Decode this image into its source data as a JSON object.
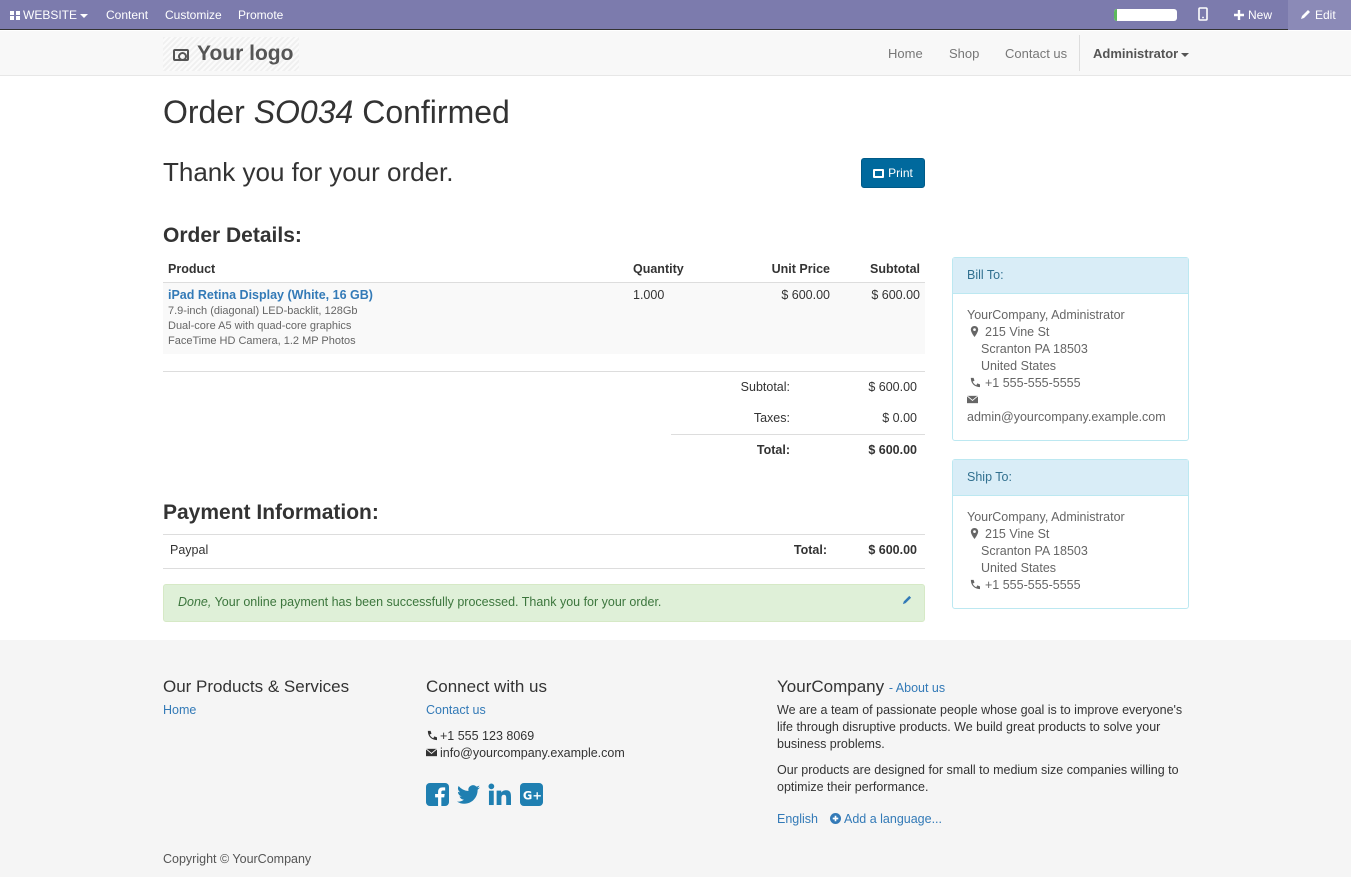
{
  "adminbar": {
    "website": "WEBSITE",
    "content": "Content",
    "customize": "Customize",
    "promote": "Promote",
    "progress": 0.05,
    "new": "New",
    "edit": "Edit"
  },
  "navbar": {
    "logo": "Your logo",
    "home": "Home",
    "shop": "Shop",
    "contact": "Contact us",
    "user": "Administrator"
  },
  "order": {
    "title_prefix": "Order",
    "title_ref": "SO034",
    "title_suffix": "Confirmed",
    "thanks": "Thank you for your order.",
    "print": "Print",
    "details_heading": "Order Details:",
    "columns": [
      "Product",
      "Quantity",
      "Unit Price",
      "Subtotal"
    ],
    "line": {
      "name": "iPad Retina Display (White, 16 GB)",
      "desc1": "7.9-inch (diagonal) LED-backlit, 128Gb",
      "desc2": "Dual-core A5 with quad-core graphics",
      "desc3": "FaceTime HD Camera, 1.2 MP Photos",
      "qty": "1.000",
      "unit": "$ 600.00",
      "subtotal": "$ 600.00"
    },
    "subtotal_label": "Subtotal:",
    "subtotal_value": "$ 600.00",
    "taxes_label": "Taxes:",
    "taxes_value": "$ 0.00",
    "total_label": "Total:",
    "total_value": "$ 600.00"
  },
  "payment": {
    "heading": "Payment Information:",
    "method": "Paypal",
    "total_label": "Total:",
    "total_value": "$ 600.00",
    "alert_em": "Done,",
    "alert_text": " Your online payment has been successfully processed. Thank you for your order."
  },
  "bill": {
    "title": "Bill To:",
    "name": "YourCompany, Administrator",
    "street": "215 Vine St",
    "city": "Scranton PA 18503",
    "country": "United States",
    "phone": "+1 555-555-5555",
    "email": "admin@yourcompany.example.com"
  },
  "ship": {
    "title": "Ship To:",
    "name": "YourCompany, Administrator",
    "street": "215 Vine St",
    "city": "Scranton PA 18503",
    "country": "United States",
    "phone": "+1 555-555-5555"
  },
  "footer": {
    "products_heading": "Our Products & Services",
    "products_home": "Home",
    "connect_heading": "Connect with us",
    "contact_link": "Contact us",
    "phone": "+1 555 123 8069",
    "email": "info@yourcompany.example.com",
    "company": "YourCompany",
    "about": "- About us",
    "para1": "We are a team of passionate people whose goal is to improve everyone's life through disruptive products. We build great products to solve your business problems.",
    "para2": "Our products are designed for small to medium size companies willing to optimize their performance.",
    "lang": "English",
    "add_lang": "Add a language...",
    "copyright": "Copyright © YourCompany"
  },
  "colors": {
    "adminbar": "#7c7bad",
    "link": "#337ab7",
    "primary_button": "#00699d",
    "social": "#1f7fb1"
  }
}
